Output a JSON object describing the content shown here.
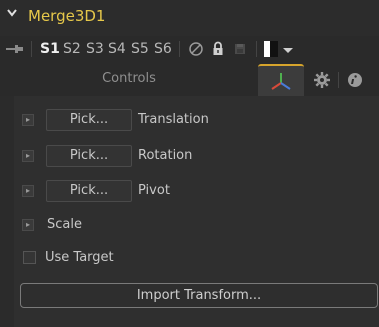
{
  "header": {
    "title": "Merge3D1",
    "colors": {
      "title": "#e6c84a",
      "accent": "#d6a42c"
    }
  },
  "versions": {
    "items": [
      "S1",
      "S2",
      "S3",
      "S4",
      "S5",
      "S6"
    ],
    "active": "S1"
  },
  "tabs": {
    "controls_label": "Controls",
    "active_tab": "3d-transform"
  },
  "controls": {
    "pick_label": "Pick...",
    "translation_label": "Translation",
    "rotation_label": "Rotation",
    "pivot_label": "Pivot",
    "scale_label": "Scale",
    "use_target_label": "Use Target",
    "use_target_checked": false,
    "import_transform_label": "Import Transform..."
  },
  "icons": {
    "collapse": "chevron-down-icon",
    "pin": "pin-icon",
    "disable": "circle-slash-icon",
    "lock": "lock-icon",
    "save": "disk-icon",
    "color": "color-swatch-icon",
    "menu": "dropdown-arrow-icon",
    "tab3d": "axes-3d-icon",
    "gear": "gear-icon",
    "info": "info-icon"
  }
}
